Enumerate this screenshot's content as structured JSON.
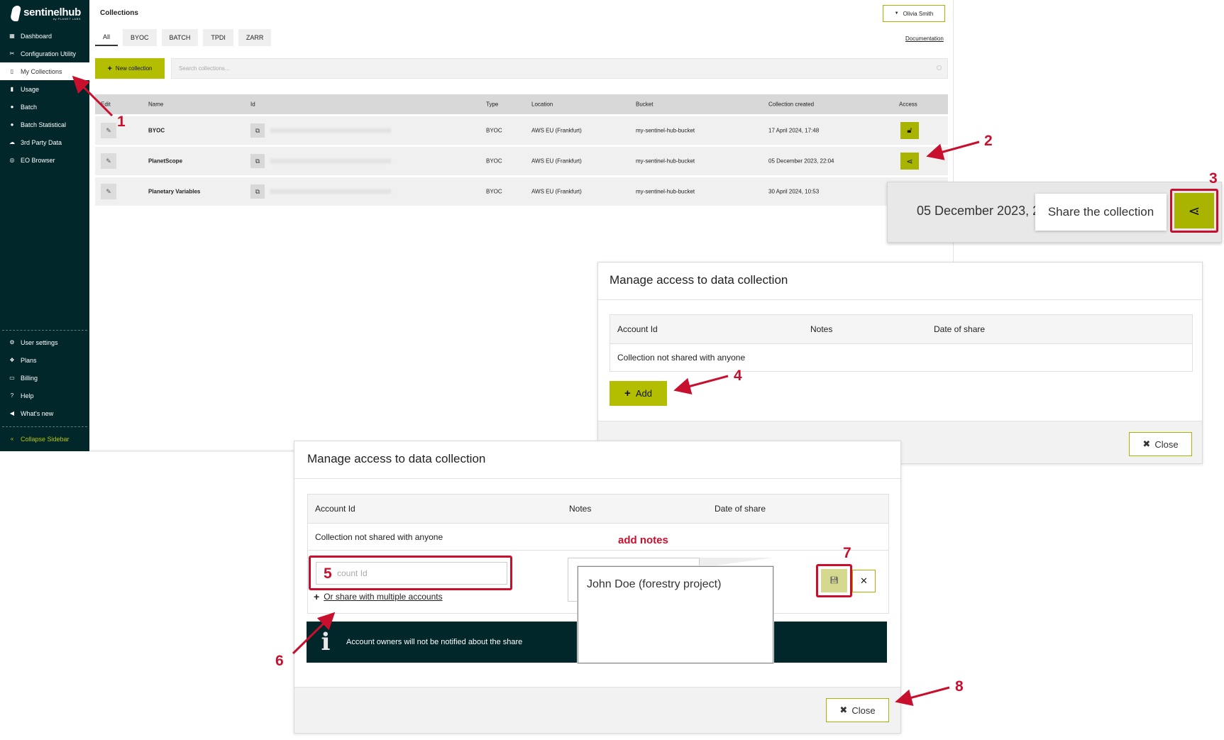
{
  "brand": {
    "name": "sentinelhub",
    "sub": "by PLANET LABS"
  },
  "sidebar": {
    "items": [
      {
        "label": "Dashboard",
        "icon": "grid-icon"
      },
      {
        "label": "Configuration Utility",
        "icon": "tools-icon"
      },
      {
        "label": "My Collections",
        "icon": "map-icon"
      },
      {
        "label": "Usage",
        "icon": "chart-icon"
      },
      {
        "label": "Batch",
        "icon": "globe-icon"
      },
      {
        "label": "Batch Statistical",
        "icon": "globe-icon"
      },
      {
        "label": "3rd Party Data",
        "icon": "cloud-icon"
      },
      {
        "label": "EO Browser",
        "icon": "globe-icon"
      }
    ],
    "bottom_items": [
      {
        "label": "User settings",
        "icon": "gears-icon"
      },
      {
        "label": "Plans",
        "icon": "dropbox-icon"
      },
      {
        "label": "Billing",
        "icon": "card-icon"
      },
      {
        "label": "Help",
        "icon": "question-icon"
      },
      {
        "label": "What's new",
        "icon": "megaphone-icon"
      }
    ],
    "collapse_label": "Collapse Sidebar"
  },
  "header": {
    "title": "Collections",
    "user": "Olivia Smith",
    "doc_link": "Documentation",
    "tabs": [
      "All",
      "BYOC",
      "BATCH",
      "TPDI",
      "ZARR"
    ],
    "new_collection": "New collection",
    "search_placeholder": "Search collections..."
  },
  "table": {
    "columns": [
      "Edit",
      "Name",
      "Id",
      "Type",
      "Location",
      "Bucket",
      "Collection created",
      "Access"
    ],
    "rows": [
      {
        "name": "BYOC",
        "type": "BYOC",
        "location": "AWS EU (Frankfurt)",
        "bucket": "my-sentinel-hub-bucket",
        "created": "17 April 2024, 17:48"
      },
      {
        "name": "PlanetScope",
        "type": "BYOC",
        "location": "AWS EU (Frankfurt)",
        "bucket": "my-sentinel-hub-bucket",
        "created": "05 December 2023, 22:04"
      },
      {
        "name": "Planetary Variables",
        "type": "BYOC",
        "location": "AWS EU (Frankfurt)",
        "bucket": "my-sentinel-hub-bucket",
        "created": "30 April 2024, 10:53"
      }
    ]
  },
  "zoom": {
    "date": "05 December 2023, 2",
    "tooltip": "Share the collection"
  },
  "dialog1": {
    "title": "Manage access to data collection",
    "cols": [
      "Account Id",
      "Notes",
      "Date of share"
    ],
    "empty": "Collection not shared with anyone",
    "add": "Add",
    "close": "Close"
  },
  "dialog2": {
    "title": "Manage access to data collection",
    "cols": [
      "Account Id",
      "Notes",
      "Date of share"
    ],
    "empty": "Collection not shared with anyone",
    "account_placeholder": "Account Id",
    "share_multi": "Or share with multiple accounts",
    "notes_value": "John Doe (forestry project)",
    "info": "Account owners will not be notified about the share",
    "close": "Close"
  },
  "annotations": {
    "n1": "1",
    "n2": "2",
    "n3": "3",
    "n4": "4",
    "n5": "5",
    "n6": "6",
    "n7": "7",
    "n8": "8",
    "add_notes": "add notes",
    "color": "#c8102e"
  },
  "colors": {
    "sidebar": "#02272b",
    "accent": "#b3be00"
  }
}
